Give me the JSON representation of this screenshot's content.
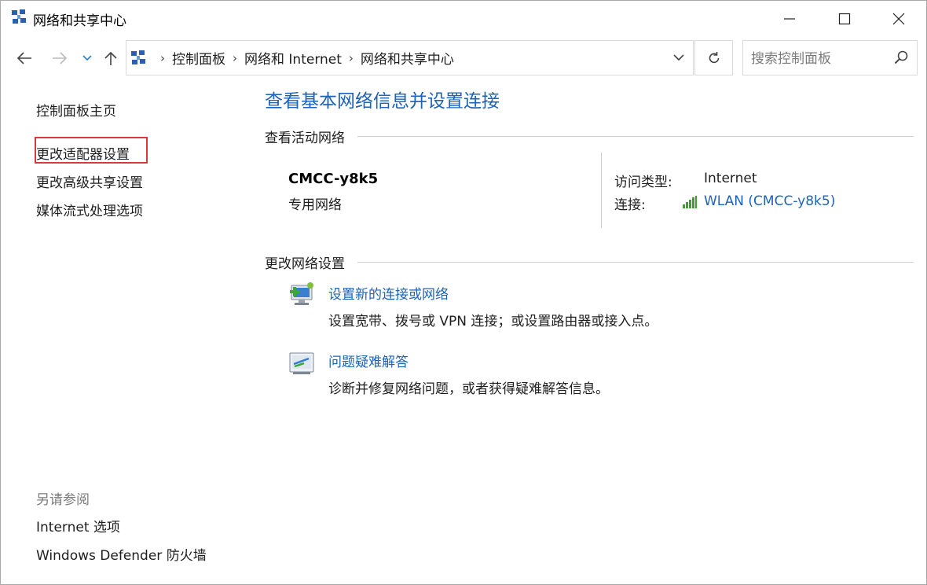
{
  "window": {
    "title": "网络和共享中心",
    "controls": {
      "minimize": "minimize-icon",
      "maximize": "maximize-icon",
      "close": "close-icon"
    }
  },
  "nav": {
    "breadcrumbs": [
      "控制面板",
      "网络和 Internet",
      "网络和共享中心"
    ],
    "search_placeholder": "搜索控制面板"
  },
  "sidebar": {
    "home": "控制面板主页",
    "items": [
      "更改适配器设置",
      "更改高级共享设置",
      "媒体流式处理选项"
    ],
    "highlighted_item": "更改适配器设置",
    "see_also_title": "另请参阅",
    "see_also_items": [
      "Internet 选项",
      "Windows Defender 防火墙"
    ]
  },
  "main": {
    "title": "查看基本网络信息并设置连接",
    "active_networks_label": "查看活动网络",
    "network": {
      "name": "CMCC-y8k5",
      "type": "专用网络",
      "access_type_label": "访问类型:",
      "access_type_value": "Internet",
      "connection_label": "连接:",
      "connection_value": "WLAN (CMCC-y8k5)"
    },
    "change_settings_label": "更改网络设置",
    "tasks": [
      {
        "title": "设置新的连接或网络",
        "desc": "设置宽带、拨号或 VPN 连接；或设置路由器或接入点。",
        "icon": "network-setup-icon"
      },
      {
        "title": "问题疑难解答",
        "desc": "诊断并修复网络问题，或者获得疑难解答信息。",
        "icon": "troubleshoot-icon"
      }
    ]
  },
  "colors": {
    "link": "#1c63b7",
    "highlight_border": "#d83a3a",
    "signal": "#3aa12a"
  }
}
